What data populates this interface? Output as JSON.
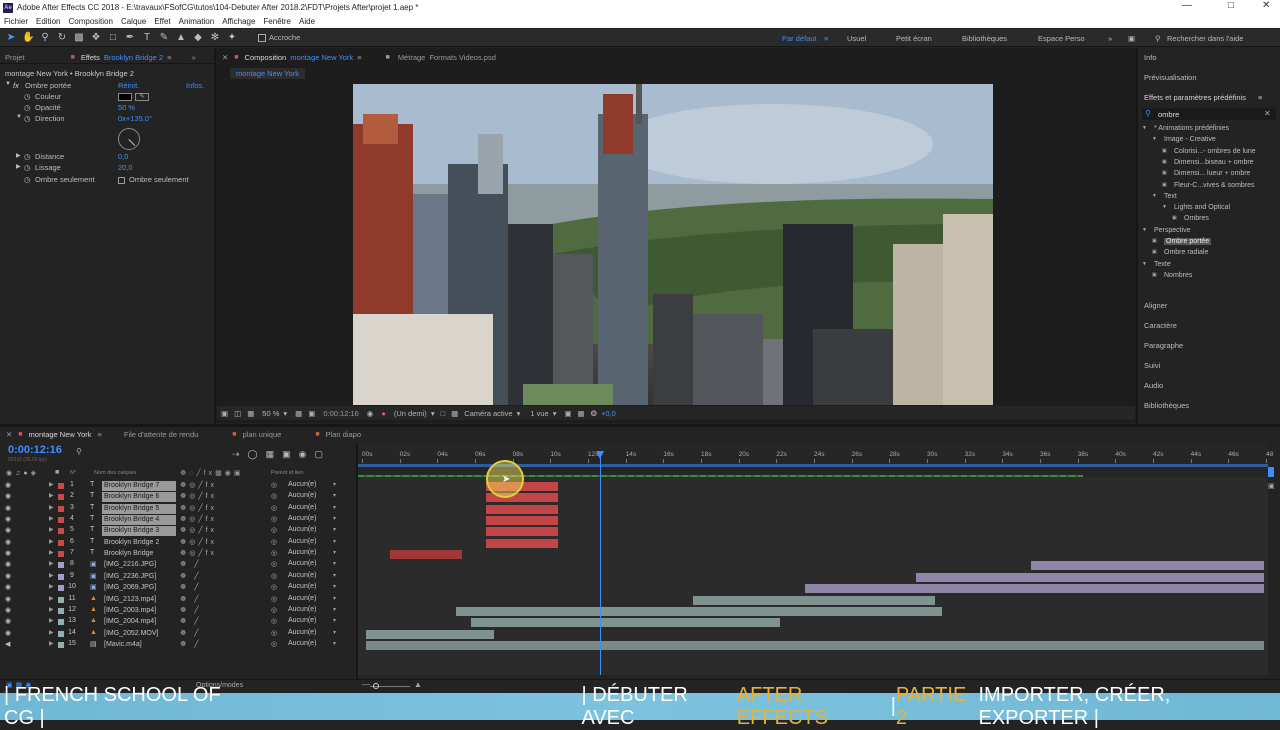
{
  "window": {
    "title": "Adobe After Effects CC 2018 - E:\\travaux\\FSofCG\\tutos\\104-Debuter After 2018.2\\FDT\\Projets After\\projet 1.aep *",
    "logo_text": "Ae"
  },
  "menu": [
    "Fichier",
    "Edition",
    "Composition",
    "Calque",
    "Effet",
    "Animation",
    "Affichage",
    "Fenêtre",
    "Aide"
  ],
  "toolbar": {
    "snap_label": "Accroche",
    "workspaces": [
      "Par défaut",
      "Usuel",
      "Petit écran",
      "Bibliothèques",
      "Espace Perso"
    ],
    "help_search_placeholder": "Rechercher dans l'aide"
  },
  "left_panel": {
    "tab_project": "Projet",
    "tab_effects": "Effets",
    "tab_effects_target": "Brooklyn Bridge 2",
    "header": "montage New York • Brooklyn Bridge 2",
    "effect_name": "Ombre portée",
    "reset": "Réinit.",
    "infos": "Infos.",
    "props": [
      {
        "label": "Couleur",
        "value": ""
      },
      {
        "label": "Opacité",
        "value": "50 %"
      },
      {
        "label": "Direction",
        "value": "0x+135,0°"
      },
      {
        "label": "Distance",
        "value": "0,0"
      },
      {
        "label": "Lissage",
        "value": "20,0"
      },
      {
        "label": "Ombre seulement",
        "value": "Ombre seulement"
      }
    ]
  },
  "comp_panel": {
    "tab_prefix": "Composition",
    "comp_name": "montage New York",
    "footage_tab": "Métrage",
    "footage_name": "Formats Videos.psd",
    "breadcrumb": "montage New York",
    "zoom": "50 %",
    "timecode": "0:00:12:16",
    "resolution": "(Un demi)",
    "camera": "Caméra active",
    "views": "1 vue",
    "exposure": "+0,0"
  },
  "right_panel": {
    "sections_top": [
      "Info",
      "Prévisualisation"
    ],
    "effects_title": "Effets et paramètres prédéfinis",
    "search_value": "ombre",
    "tree": [
      {
        "label": "* Animations prédéfinies",
        "level": 0
      },
      {
        "label": "Image - Creative",
        "level": 1
      },
      {
        "label": "Colorisi...- ombres de lune",
        "level": 2
      },
      {
        "label": "Dimensi...biseau + ombre",
        "level": 2
      },
      {
        "label": "Dimensi... lueur + ombre",
        "level": 2
      },
      {
        "label": "Fleur-C...vives & sombres",
        "level": 2
      },
      {
        "label": "Text",
        "level": 1
      },
      {
        "label": "Lights and Optical",
        "level": 2
      },
      {
        "label": "Ombres",
        "level": 3
      },
      {
        "label": "Perspective",
        "level": 0
      },
      {
        "label": "Ombre portée",
        "level": 1,
        "selected": true
      },
      {
        "label": "Ombre radiale",
        "level": 1
      },
      {
        "label": "Texte",
        "level": 0
      },
      {
        "label": "Nombres",
        "level": 1
      }
    ],
    "sections_bottom": [
      "Aligner",
      "Caractère",
      "Paragraphe",
      "Suivi",
      "Audio",
      "Bibliothèques"
    ]
  },
  "timeline": {
    "tabs": [
      "montage New York",
      "File d'attente de rendu",
      "plan unique",
      "Plan diapo"
    ],
    "timecode": "0:00:12:16",
    "timecode_sub": "00316 (25.00 ips)",
    "col_hash": "N°",
    "col_layer_name": "Nom des calques",
    "col_parent": "Parent et lien",
    "ruler": [
      "00s",
      "02s",
      "04s",
      "06s",
      "08s",
      "10s",
      "12s",
      "14s",
      "16s",
      "18s",
      "20s",
      "22s",
      "24s",
      "26s",
      "28s",
      "30s",
      "32s",
      "34s",
      "36s",
      "38s",
      "40s",
      "42s",
      "44s",
      "46s",
      "48"
    ],
    "layers": [
      {
        "num": "1",
        "type": "T",
        "name": "Brooklyn Bridge 7",
        "color": "#c94a4a",
        "selected": true,
        "parent": "Aucun(e)"
      },
      {
        "num": "2",
        "type": "T",
        "name": "Brooklyn Bridge 6",
        "color": "#c94a4a",
        "selected": true,
        "parent": "Aucun(e)"
      },
      {
        "num": "3",
        "type": "T",
        "name": "Brooklyn Bridge 5",
        "color": "#c94a4a",
        "selected": true,
        "parent": "Aucun(e)"
      },
      {
        "num": "4",
        "type": "T",
        "name": "Brooklyn Bridge 4",
        "color": "#c94a4a",
        "selected": true,
        "parent": "Aucun(e)"
      },
      {
        "num": "5",
        "type": "T",
        "name": "Brooklyn Bridge 3",
        "color": "#c94a4a",
        "selected": true,
        "parent": "Aucun(e)"
      },
      {
        "num": "6",
        "type": "T",
        "name": "Brooklyn Bridge 2",
        "color": "#c94a4a",
        "selected": false,
        "parent": "Aucun(e)"
      },
      {
        "num": "7",
        "type": "T",
        "name": "Brooklyn Bridge",
        "color": "#c94a4a",
        "selected": false,
        "parent": "Aucun(e)"
      },
      {
        "num": "8",
        "type": "img",
        "name": "[IMG_2216.JPG]",
        "color": "#a99bc9",
        "selected": false,
        "parent": "Aucun(e)"
      },
      {
        "num": "9",
        "type": "img",
        "name": "[IMG_2236.JPG]",
        "color": "#a99bc9",
        "selected": false,
        "parent": "Aucun(e)"
      },
      {
        "num": "10",
        "type": "img",
        "name": "[IMG_2069.JPG]",
        "color": "#a99bc9",
        "selected": false,
        "parent": "Aucun(e)"
      },
      {
        "num": "11",
        "type": "vid",
        "name": "[IMG_2123.mp4]",
        "color": "#8fb0b0",
        "selected": false,
        "parent": "Aucun(e)"
      },
      {
        "num": "12",
        "type": "vid",
        "name": "[IMG_2003.mp4]",
        "color": "#8fb0b0",
        "selected": false,
        "parent": "Aucun(e)"
      },
      {
        "num": "13",
        "type": "vid",
        "name": "[IMG_2004.mp4]",
        "color": "#8fb0b0",
        "selected": false,
        "parent": "Aucun(e)"
      },
      {
        "num": "14",
        "type": "vid",
        "name": "[IMG_2052.MOV]",
        "color": "#8fb0b0",
        "selected": false,
        "parent": "Aucun(e)"
      },
      {
        "num": "15",
        "type": "aud",
        "name": "[Mavic.m4a]",
        "color": "#8fb0b0",
        "selected": false,
        "parent": "Aucun(e)"
      }
    ],
    "layer_spans_seconds": [
      [
        6.6,
        10.4
      ],
      [
        6.6,
        10.4
      ],
      [
        6.6,
        10.4
      ],
      [
        6.6,
        10.4
      ],
      [
        6.6,
        10.4
      ],
      [
        6.6,
        10.4
      ],
      [
        1.5,
        5.3
      ],
      [
        35.5,
        48
      ],
      [
        29.4,
        48
      ],
      [
        23.5,
        48
      ],
      [
        17.6,
        30.4
      ],
      [
        5.0,
        30.8
      ],
      [
        5.8,
        22.2
      ],
      [
        0.2,
        7.0
      ],
      [
        0.2,
        48
      ]
    ],
    "bar_colors": [
      "#c24646",
      "#c24646",
      "#c24646",
      "#c24646",
      "#c24646",
      "#c24646",
      "#a03838",
      "#8f85a9",
      "#8f85a9",
      "#8f85a9",
      "#7f9391",
      "#7f9391",
      "#7f9391",
      "#7f9391",
      "#7b8a89"
    ],
    "playhead_seconds": 12.64,
    "duration_seconds": 48,
    "footer": "Options/modes"
  },
  "banner": {
    "left": "| FRENCH SCHOOL OF CG |",
    "sep1": "| DÉBUTER AVEC ",
    "highlight1": "AFTER EFFECTS",
    "sep2": " | ",
    "highlight2": "PARTIE 2",
    "right": " IMPORTER, CRÉER, EXPORTER |",
    "highlight_color": "#e8b23a"
  }
}
